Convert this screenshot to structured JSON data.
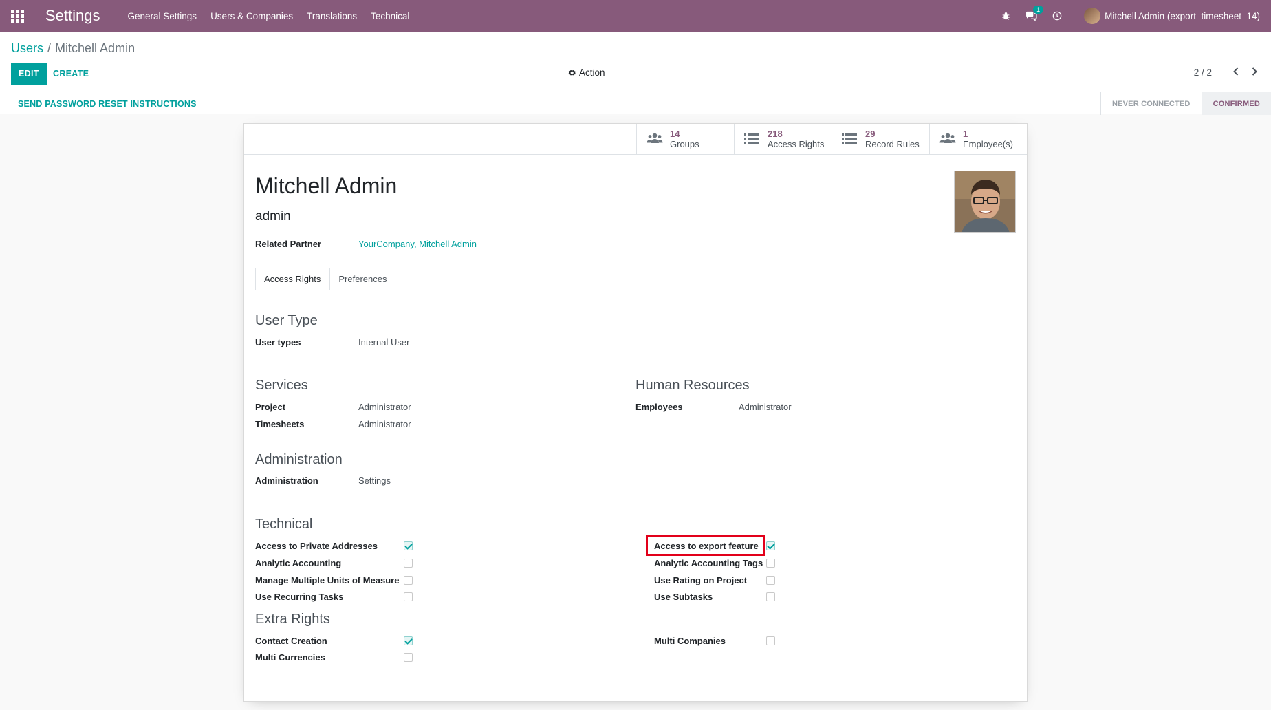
{
  "navbar": {
    "app_title": "Settings",
    "menu": [
      "General Settings",
      "Users & Companies",
      "Translations",
      "Technical"
    ],
    "chat_badge": "1",
    "user_label": "Mitchell Admin (export_timesheet_14)"
  },
  "control_panel": {
    "breadcrumb_parent": "Users",
    "breadcrumb_current": "Mitchell Admin",
    "edit_label": "EDIT",
    "create_label": "CREATE",
    "action_label": "Action",
    "pager": "2 / 2"
  },
  "statusbar": {
    "reset_label": "SEND PASSWORD RESET INSTRUCTIONS",
    "steps": [
      "NEVER CONNECTED",
      "CONFIRMED"
    ]
  },
  "smart_buttons": [
    {
      "count": "14",
      "label": "Groups",
      "icon": "users-icon"
    },
    {
      "count": "218",
      "label": "Access Rights",
      "icon": "list-icon"
    },
    {
      "count": "29",
      "label": "Record Rules",
      "icon": "list-icon"
    },
    {
      "count": "1",
      "label": "Employee(s)",
      "icon": "users-icon"
    }
  ],
  "user": {
    "name": "Mitchell Admin",
    "login": "admin",
    "related_partner_label": "Related Partner",
    "related_partner_value": "YourCompany, Mitchell Admin"
  },
  "tabs": [
    "Access Rights",
    "Preferences"
  ],
  "sections": {
    "user_type": {
      "title": "User Type",
      "label": "User types",
      "value": "Internal User"
    },
    "services": {
      "title": "Services",
      "rows": [
        {
          "label": "Project",
          "value": "Administrator"
        },
        {
          "label": "Timesheets",
          "value": "Administrator"
        }
      ]
    },
    "human_resources": {
      "title": "Human Resources",
      "rows": [
        {
          "label": "Employees",
          "value": "Administrator"
        }
      ]
    },
    "administration": {
      "title": "Administration",
      "rows": [
        {
          "label": "Administration",
          "value": "Settings"
        }
      ]
    },
    "technical": {
      "title": "Technical",
      "left": [
        {
          "label": "Access to Private Addresses",
          "checked": true
        },
        {
          "label": "Analytic Accounting",
          "checked": false
        },
        {
          "label": "Manage Multiple Units of Measure",
          "checked": false
        },
        {
          "label": "Use Recurring Tasks",
          "checked": false
        }
      ],
      "right": [
        {
          "label": "Access to export feature",
          "checked": true
        },
        {
          "label": "Analytic Accounting Tags",
          "checked": false
        },
        {
          "label": "Use Rating on Project",
          "checked": false
        },
        {
          "label": "Use Subtasks",
          "checked": false
        }
      ]
    },
    "extra_rights": {
      "title": "Extra Rights",
      "left": [
        {
          "label": "Contact Creation",
          "checked": true
        },
        {
          "label": "Multi Currencies",
          "checked": false
        }
      ],
      "right": [
        {
          "label": "Multi Companies",
          "checked": false
        }
      ]
    }
  },
  "colors": {
    "navbar": "#875a7b",
    "accent": "#00a09d",
    "highlight": "#e2001a"
  }
}
